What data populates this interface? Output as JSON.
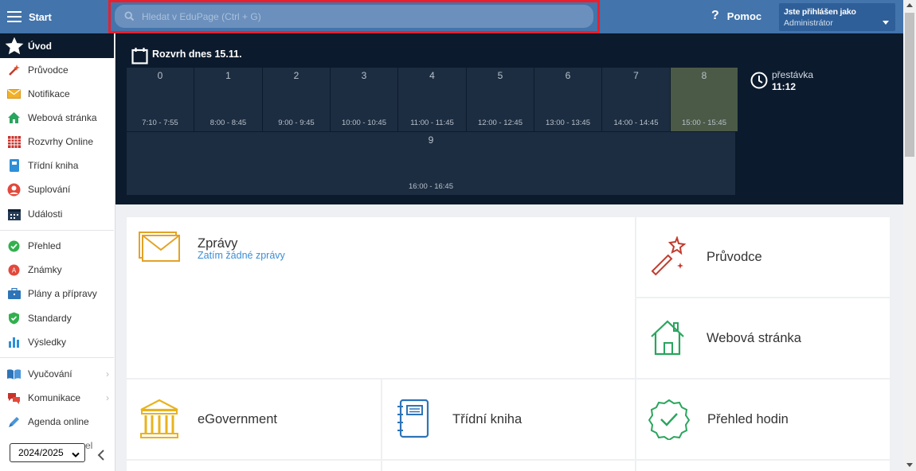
{
  "topbar": {
    "start_label": "Start",
    "search_placeholder": "Hledat v EduPage (Ctrl + G)",
    "help_icon": "?",
    "help_label": "Pomoc",
    "user_line1": "Jste přihlášen jako",
    "user_line2": "Administrátor"
  },
  "sidebar": {
    "items": [
      {
        "label": "Úvod",
        "icon": "star-icon"
      },
      {
        "label": "Průvodce",
        "icon": "magic-wand-icon"
      },
      {
        "label": "Notifikace",
        "icon": "envelope-icon"
      },
      {
        "label": "Webová stránka",
        "icon": "house-icon"
      },
      {
        "label": "Rozvrhy Online",
        "icon": "timetable-grid-icon"
      },
      {
        "label": "Třídní kniha",
        "icon": "notebook-icon"
      },
      {
        "label": "Suplování",
        "icon": "substitute-person-icon"
      },
      {
        "label": "Události",
        "icon": "calendar-icon"
      },
      {
        "label": "Přehled",
        "icon": "check-circle-icon"
      },
      {
        "label": "Známky",
        "icon": "grades-icon"
      },
      {
        "label": "Plány a přípravy",
        "icon": "briefcase-icon"
      },
      {
        "label": "Standardy",
        "icon": "shield-check-icon"
      },
      {
        "label": "Výsledky",
        "icon": "bar-chart-icon"
      },
      {
        "label": "Vyučování",
        "icon": "open-book-icon"
      },
      {
        "label": "Komunikace",
        "icon": "chat-bubbles-icon"
      },
      {
        "label": "Agenda online",
        "icon": "pencil-icon"
      }
    ],
    "partial_text": "el",
    "year_select_value": "2024/2025",
    "collapse_glyph": "‹"
  },
  "timetable": {
    "title": "Rozvrh dnes 15.11.",
    "lessons": [
      {
        "num": "0",
        "time": "7:10 - 7:55"
      },
      {
        "num": "1",
        "time": "8:00 - 8:45"
      },
      {
        "num": "2",
        "time": "9:00 - 9:45"
      },
      {
        "num": "3",
        "time": "10:00 - 10:45"
      },
      {
        "num": "4",
        "time": "11:00 - 11:45"
      },
      {
        "num": "5",
        "time": "12:00 - 12:45"
      },
      {
        "num": "6",
        "time": "13:00 - 13:45"
      },
      {
        "num": "7",
        "time": "14:00 - 14:45"
      },
      {
        "num": "8",
        "time": "15:00 - 15:45"
      },
      {
        "num": "9",
        "time": "16:00 - 16:45"
      }
    ],
    "current_lesson": "8",
    "break_label": "přestávka",
    "break_time": "11:12"
  },
  "tiles": {
    "messages_title": "Zprávy",
    "messages_sub": "Zatím žádné zprávy",
    "wizard": "Průvodce",
    "website": "Webová stránka",
    "egov": "eGovernment",
    "classbook": "Třídní kniha",
    "attendance": "Přehled hodin"
  },
  "colors": {
    "topbar": "#4374ab",
    "dark": "#0b1a2c",
    "accent_red": "#e8202e",
    "link_blue": "#3a8fd6"
  }
}
